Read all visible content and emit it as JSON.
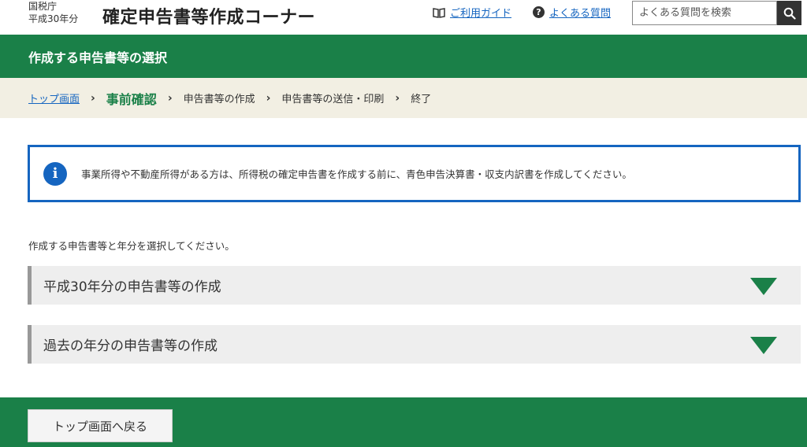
{
  "header": {
    "agency": "国税庁",
    "year": "平成30年分",
    "site_title": "確定申告書等作成コーナー",
    "guide_link": "ご利用ガイド",
    "faq_link": "よくある質問",
    "search_placeholder": "よくある質問を検索",
    "icons": {
      "guide": "book-icon",
      "faq": "help-icon",
      "search": "search-icon"
    }
  },
  "page_header": {
    "title": "作成する申告書等の選択"
  },
  "breadcrumb": {
    "steps": [
      "トップ画面",
      "事前確認",
      "申告書等の作成",
      "申告書等の送信・印刷",
      "終了"
    ],
    "current_index": 1
  },
  "info": {
    "message": "事業所得や不動産所得がある方は、所得税の確定申告書を作成する前に、青色申告決算書・収支内訳書を作成してください。",
    "icon": "info-icon"
  },
  "instruction": "作成する申告書等と年分を選択してください。",
  "accordions": [
    {
      "label": "平成30年分の申告書等の作成",
      "expanded": false
    },
    {
      "label": "過去の年分の申告書等の作成",
      "expanded": false
    }
  ],
  "footer": {
    "back_button": "トップ画面へ戻る"
  },
  "colors": {
    "primary_green": "#1a8048",
    "link_blue": "#1565c0",
    "breadcrumb_bg": "#f2efe3",
    "accordion_bg": "#eeeeee"
  }
}
